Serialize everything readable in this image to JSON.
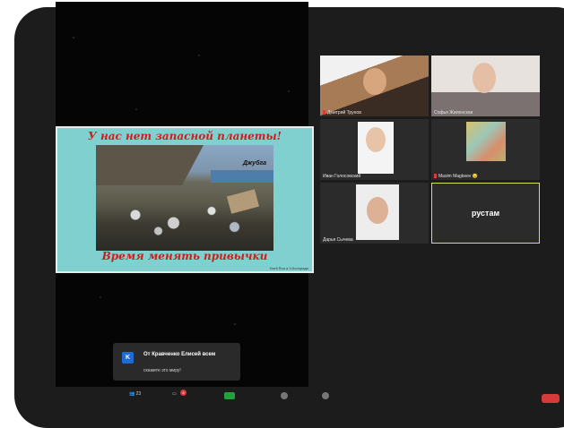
{
  "slide": {
    "title": "У нас нет запасной планеты!",
    "photo_label": "Джубга",
    "bottom": "Время менять привычки",
    "credit": "Kseli Roo a    З.Колорадо"
  },
  "participants": [
    {
      "name": "Дмитрий Трунов",
      "muted": true
    },
    {
      "name": "Софья Жиленская",
      "muted": false
    },
    {
      "name": "Иван Голосовский",
      "muted": false
    },
    {
      "name": "Maxim Magkeev 😏",
      "muted": true
    },
    {
      "name": "Дарья Сычева",
      "muted": false
    },
    {
      "name": "рустам",
      "muted": false
    }
  ],
  "toast": {
    "badge": "K",
    "title": "От Кравченко Елисей всем",
    "message": "скажите это миру!"
  },
  "toolbar": {
    "participants_count": "23",
    "chat_badge": "8"
  },
  "icons": {
    "participants": "participants-icon",
    "chat": "chat-icon",
    "share": "share-screen-icon",
    "record": "record-icon",
    "mic": "muted-mic-icon"
  },
  "colors": {
    "slide_bg": "#7fd0cf",
    "slide_title": "#d11c1c",
    "active_speaker": "#d9e44a",
    "share_green": "#1fa33a",
    "badge_red": "#d63a3a"
  }
}
